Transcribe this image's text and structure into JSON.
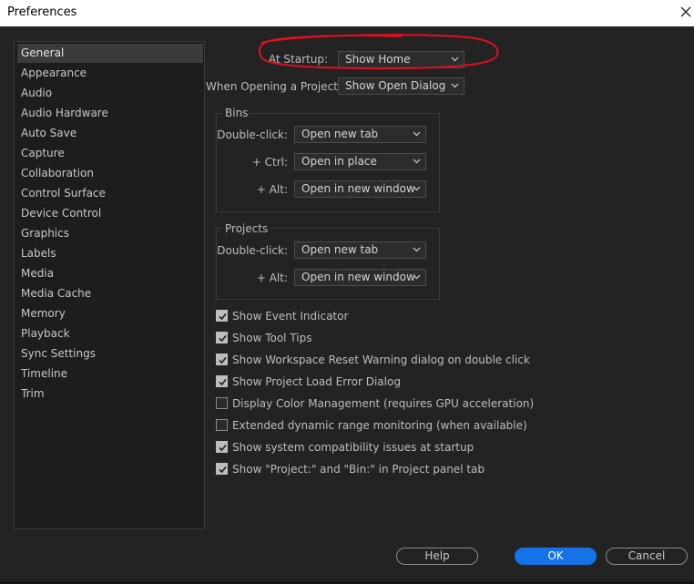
{
  "window": {
    "title": "Preferences",
    "close_icon": "close-icon"
  },
  "sidebar": {
    "items": [
      {
        "label": "General",
        "selected": true
      },
      {
        "label": "Appearance"
      },
      {
        "label": "Audio"
      },
      {
        "label": "Audio Hardware"
      },
      {
        "label": "Auto Save"
      },
      {
        "label": "Capture"
      },
      {
        "label": "Collaboration"
      },
      {
        "label": "Control Surface"
      },
      {
        "label": "Device Control"
      },
      {
        "label": "Graphics"
      },
      {
        "label": "Labels"
      },
      {
        "label": "Media"
      },
      {
        "label": "Media Cache"
      },
      {
        "label": "Memory"
      },
      {
        "label": "Playback"
      },
      {
        "label": "Sync Settings"
      },
      {
        "label": "Timeline"
      },
      {
        "label": "Trim"
      }
    ]
  },
  "general": {
    "at_startup": {
      "label": "At Startup:",
      "value": "Show Home"
    },
    "when_opening": {
      "label": "When Opening a Project:",
      "value": "Show Open Dialog"
    },
    "bins": {
      "title": "Bins",
      "rows": [
        {
          "label": "Double-click:",
          "value": "Open new tab"
        },
        {
          "label": "+ Ctrl:",
          "value": "Open in place"
        },
        {
          "label": "+ Alt:",
          "value": "Open in new window"
        }
      ]
    },
    "projects": {
      "title": "Projects",
      "rows": [
        {
          "label": "Double-click:",
          "value": "Open new tab"
        },
        {
          "label": "+ Alt:",
          "value": "Open in new window"
        }
      ]
    },
    "checkboxes": [
      {
        "label": "Show Event Indicator",
        "checked": true
      },
      {
        "label": "Show Tool Tips",
        "checked": true
      },
      {
        "label": "Show Workspace Reset Warning dialog on double click",
        "checked": true
      },
      {
        "label": "Show Project Load Error Dialog",
        "checked": true
      },
      {
        "label": "Display Color Management (requires GPU acceleration)",
        "checked": false
      },
      {
        "label": "Extended dynamic range monitoring (when available)",
        "checked": false
      },
      {
        "label": "Show system compatibility issues at startup",
        "checked": true
      },
      {
        "label": "Show \"Project:\" and \"Bin:\" in Project panel tab",
        "checked": true
      }
    ]
  },
  "buttons": {
    "help": "Help",
    "ok": "OK",
    "cancel": "Cancel"
  },
  "colors": {
    "background": "#232323",
    "panel": "#1d1d1d",
    "accent": "#1473e6",
    "annotation": "#e0101f"
  },
  "icons": {
    "dropdown": "chevron-down-icon",
    "checkbox": "check-icon"
  }
}
